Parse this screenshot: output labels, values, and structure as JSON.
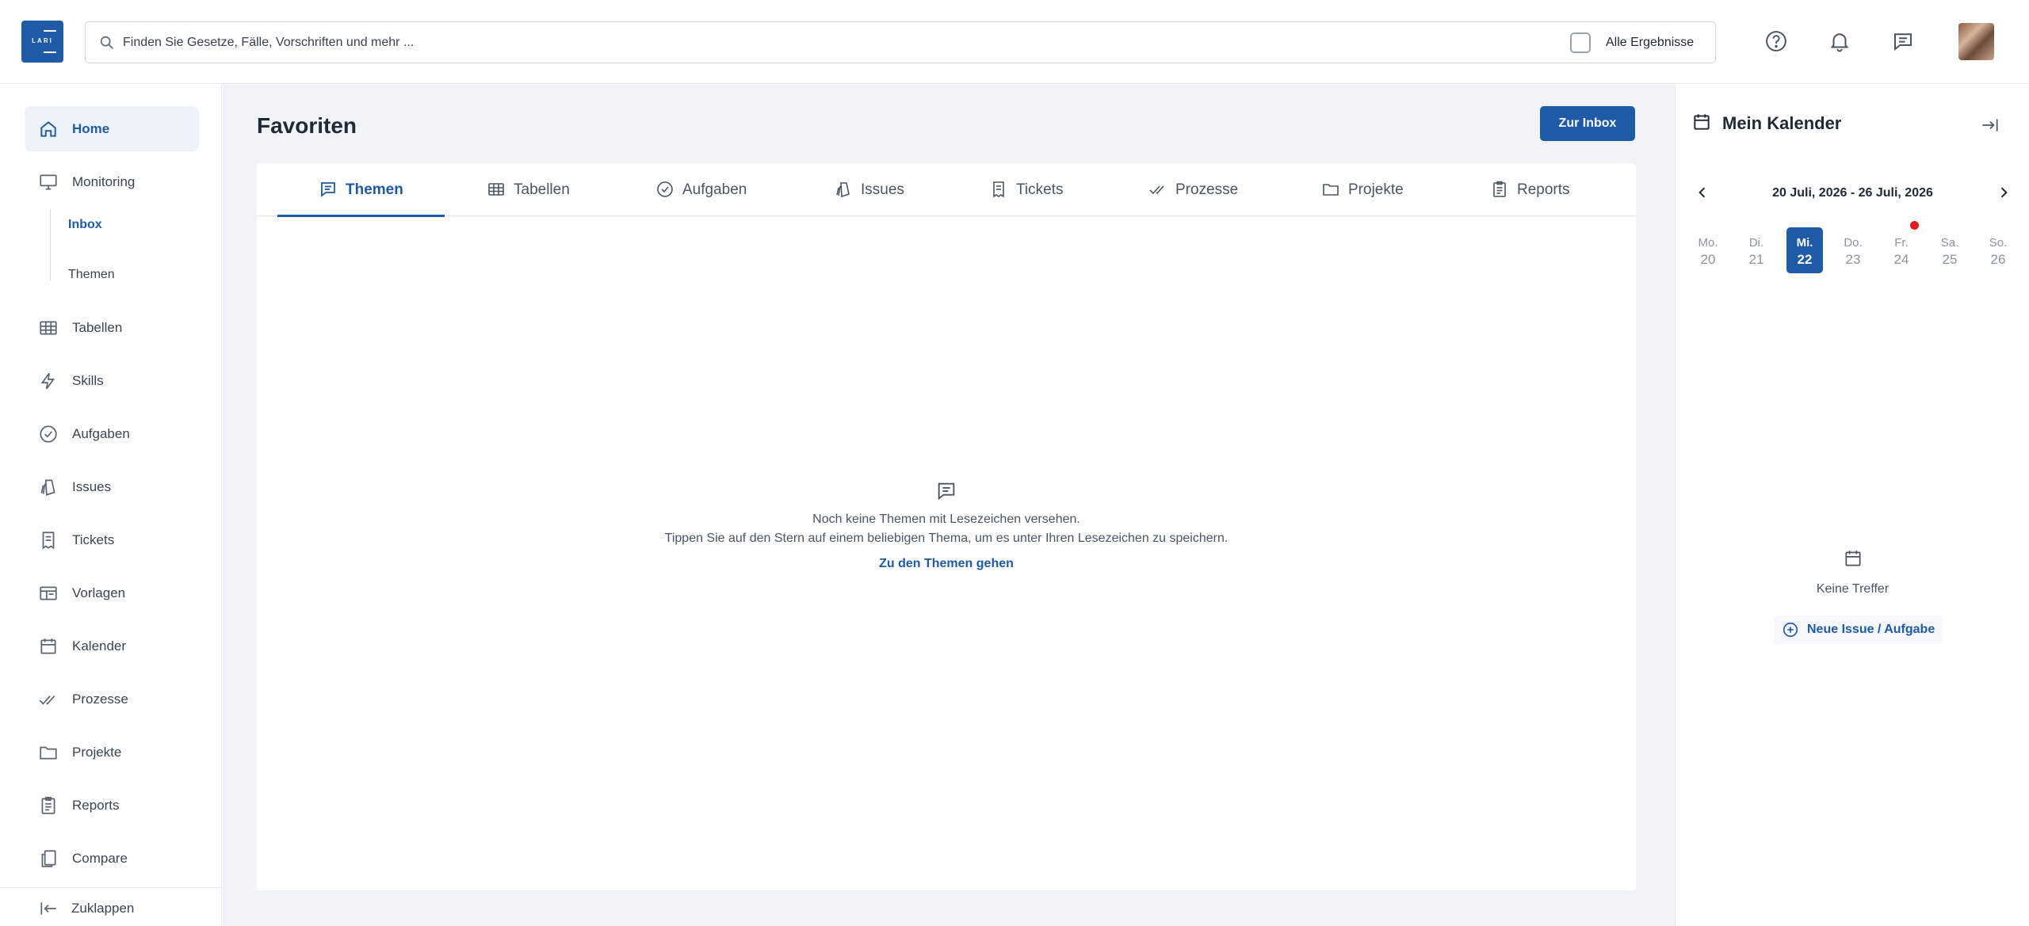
{
  "header": {
    "logo_text": "LARI",
    "search_placeholder": "Finden Sie Gesetze, Fälle, Vorschriften und mehr ...",
    "all_results_label": "Alle Ergebnisse",
    "icons": [
      "help-icon",
      "bell-icon",
      "chat-icon"
    ]
  },
  "sidebar": {
    "items": [
      {
        "label": "Home",
        "icon": "home-icon"
      },
      {
        "label": "Monitoring",
        "icon": "monitor-icon"
      },
      {
        "label": "Tabellen",
        "icon": "table-icon"
      },
      {
        "label": "Skills",
        "icon": "bolt-icon"
      },
      {
        "label": "Aufgaben",
        "icon": "check-circle-icon"
      },
      {
        "label": "Issues",
        "icon": "issues-icon"
      },
      {
        "label": "Tickets",
        "icon": "ticket-icon"
      },
      {
        "label": "Vorlagen",
        "icon": "template-icon"
      },
      {
        "label": "Kalender",
        "icon": "calendar-icon"
      },
      {
        "label": "Prozesse",
        "icon": "double-check-icon"
      },
      {
        "label": "Projekte",
        "icon": "folder-icon"
      },
      {
        "label": "Reports",
        "icon": "clipboard-icon"
      },
      {
        "label": "Compare",
        "icon": "compare-icon"
      }
    ],
    "subitems": [
      {
        "label": "Inbox"
      },
      {
        "label": "Themen"
      }
    ],
    "collapse_label": "Zuklappen"
  },
  "main": {
    "title": "Favoriten",
    "inbox_button": "Zur Inbox",
    "tabs": [
      {
        "label": "Themen",
        "icon": "chat-icon"
      },
      {
        "label": "Tabellen",
        "icon": "table-icon"
      },
      {
        "label": "Aufgaben",
        "icon": "check-circle-icon"
      },
      {
        "label": "Issues",
        "icon": "issues-icon"
      },
      {
        "label": "Tickets",
        "icon": "ticket-icon"
      },
      {
        "label": "Prozesse",
        "icon": "double-check-icon"
      },
      {
        "label": "Projekte",
        "icon": "folder-icon"
      },
      {
        "label": "Reports",
        "icon": "clipboard-icon"
      }
    ],
    "empty": {
      "line1": "Noch keine Themen mit Lesezeichen versehen.",
      "line2": "Tippen Sie auf den Stern auf einem beliebigen Thema, um es unter Ihren Lesezeichen zu speichern.",
      "link": "Zu den Themen gehen"
    }
  },
  "calendar": {
    "title": "Mein Kalender",
    "range": "20 Juli, 2026 - 26 Juli, 2026",
    "days": [
      {
        "name": "Mo.",
        "date": "20"
      },
      {
        "name": "Di.",
        "date": "21"
      },
      {
        "name": "Mi.",
        "date": "22"
      },
      {
        "name": "Do.",
        "date": "23"
      },
      {
        "name": "Fr.",
        "date": "24"
      },
      {
        "name": "Sa.",
        "date": "25"
      },
      {
        "name": "So.",
        "date": "26"
      }
    ],
    "selected_day": "22",
    "no_results": "Keine Treffer",
    "new_issue": "Neue Issue / Aufgabe",
    "accent_color": "#1f5aa6",
    "event_dot_color": "#e11d1d"
  }
}
